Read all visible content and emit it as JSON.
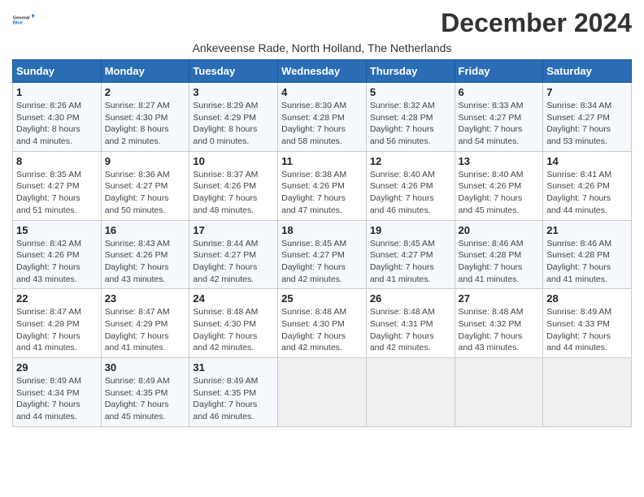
{
  "logo": {
    "line1": "General",
    "line2": "Blue"
  },
  "title": "December 2024",
  "subtitle": "Ankeveense Rade, North Holland, The Netherlands",
  "days_of_week": [
    "Sunday",
    "Monday",
    "Tuesday",
    "Wednesday",
    "Thursday",
    "Friday",
    "Saturday"
  ],
  "weeks": [
    [
      {
        "day": "1",
        "info": "Sunrise: 8:26 AM\nSunset: 4:30 PM\nDaylight: 8 hours\nand 4 minutes."
      },
      {
        "day": "2",
        "info": "Sunrise: 8:27 AM\nSunset: 4:30 PM\nDaylight: 8 hours\nand 2 minutes."
      },
      {
        "day": "3",
        "info": "Sunrise: 8:29 AM\nSunset: 4:29 PM\nDaylight: 8 hours\nand 0 minutes."
      },
      {
        "day": "4",
        "info": "Sunrise: 8:30 AM\nSunset: 4:28 PM\nDaylight: 7 hours\nand 58 minutes."
      },
      {
        "day": "5",
        "info": "Sunrise: 8:32 AM\nSunset: 4:28 PM\nDaylight: 7 hours\nand 56 minutes."
      },
      {
        "day": "6",
        "info": "Sunrise: 8:33 AM\nSunset: 4:27 PM\nDaylight: 7 hours\nand 54 minutes."
      },
      {
        "day": "7",
        "info": "Sunrise: 8:34 AM\nSunset: 4:27 PM\nDaylight: 7 hours\nand 53 minutes."
      }
    ],
    [
      {
        "day": "8",
        "info": "Sunrise: 8:35 AM\nSunset: 4:27 PM\nDaylight: 7 hours\nand 51 minutes."
      },
      {
        "day": "9",
        "info": "Sunrise: 8:36 AM\nSunset: 4:27 PM\nDaylight: 7 hours\nand 50 minutes."
      },
      {
        "day": "10",
        "info": "Sunrise: 8:37 AM\nSunset: 4:26 PM\nDaylight: 7 hours\nand 48 minutes."
      },
      {
        "day": "11",
        "info": "Sunrise: 8:38 AM\nSunset: 4:26 PM\nDaylight: 7 hours\nand 47 minutes."
      },
      {
        "day": "12",
        "info": "Sunrise: 8:40 AM\nSunset: 4:26 PM\nDaylight: 7 hours\nand 46 minutes."
      },
      {
        "day": "13",
        "info": "Sunrise: 8:40 AM\nSunset: 4:26 PM\nDaylight: 7 hours\nand 45 minutes."
      },
      {
        "day": "14",
        "info": "Sunrise: 8:41 AM\nSunset: 4:26 PM\nDaylight: 7 hours\nand 44 minutes."
      }
    ],
    [
      {
        "day": "15",
        "info": "Sunrise: 8:42 AM\nSunset: 4:26 PM\nDaylight: 7 hours\nand 43 minutes."
      },
      {
        "day": "16",
        "info": "Sunrise: 8:43 AM\nSunset: 4:26 PM\nDaylight: 7 hours\nand 43 minutes."
      },
      {
        "day": "17",
        "info": "Sunrise: 8:44 AM\nSunset: 4:27 PM\nDaylight: 7 hours\nand 42 minutes."
      },
      {
        "day": "18",
        "info": "Sunrise: 8:45 AM\nSunset: 4:27 PM\nDaylight: 7 hours\nand 42 minutes."
      },
      {
        "day": "19",
        "info": "Sunrise: 8:45 AM\nSunset: 4:27 PM\nDaylight: 7 hours\nand 41 minutes."
      },
      {
        "day": "20",
        "info": "Sunrise: 8:46 AM\nSunset: 4:28 PM\nDaylight: 7 hours\nand 41 minutes."
      },
      {
        "day": "21",
        "info": "Sunrise: 8:46 AM\nSunset: 4:28 PM\nDaylight: 7 hours\nand 41 minutes."
      }
    ],
    [
      {
        "day": "22",
        "info": "Sunrise: 8:47 AM\nSunset: 4:29 PM\nDaylight: 7 hours\nand 41 minutes."
      },
      {
        "day": "23",
        "info": "Sunrise: 8:47 AM\nSunset: 4:29 PM\nDaylight: 7 hours\nand 41 minutes."
      },
      {
        "day": "24",
        "info": "Sunrise: 8:48 AM\nSunset: 4:30 PM\nDaylight: 7 hours\nand 42 minutes."
      },
      {
        "day": "25",
        "info": "Sunrise: 8:48 AM\nSunset: 4:30 PM\nDaylight: 7 hours\nand 42 minutes."
      },
      {
        "day": "26",
        "info": "Sunrise: 8:48 AM\nSunset: 4:31 PM\nDaylight: 7 hours\nand 42 minutes."
      },
      {
        "day": "27",
        "info": "Sunrise: 8:48 AM\nSunset: 4:32 PM\nDaylight: 7 hours\nand 43 minutes."
      },
      {
        "day": "28",
        "info": "Sunrise: 8:49 AM\nSunset: 4:33 PM\nDaylight: 7 hours\nand 44 minutes."
      }
    ],
    [
      {
        "day": "29",
        "info": "Sunrise: 8:49 AM\nSunset: 4:34 PM\nDaylight: 7 hours\nand 44 minutes."
      },
      {
        "day": "30",
        "info": "Sunrise: 8:49 AM\nSunset: 4:35 PM\nDaylight: 7 hours\nand 45 minutes."
      },
      {
        "day": "31",
        "info": "Sunrise: 8:49 AM\nSunset: 4:35 PM\nDaylight: 7 hours\nand 46 minutes."
      },
      {
        "day": "",
        "info": ""
      },
      {
        "day": "",
        "info": ""
      },
      {
        "day": "",
        "info": ""
      },
      {
        "day": "",
        "info": ""
      }
    ]
  ]
}
